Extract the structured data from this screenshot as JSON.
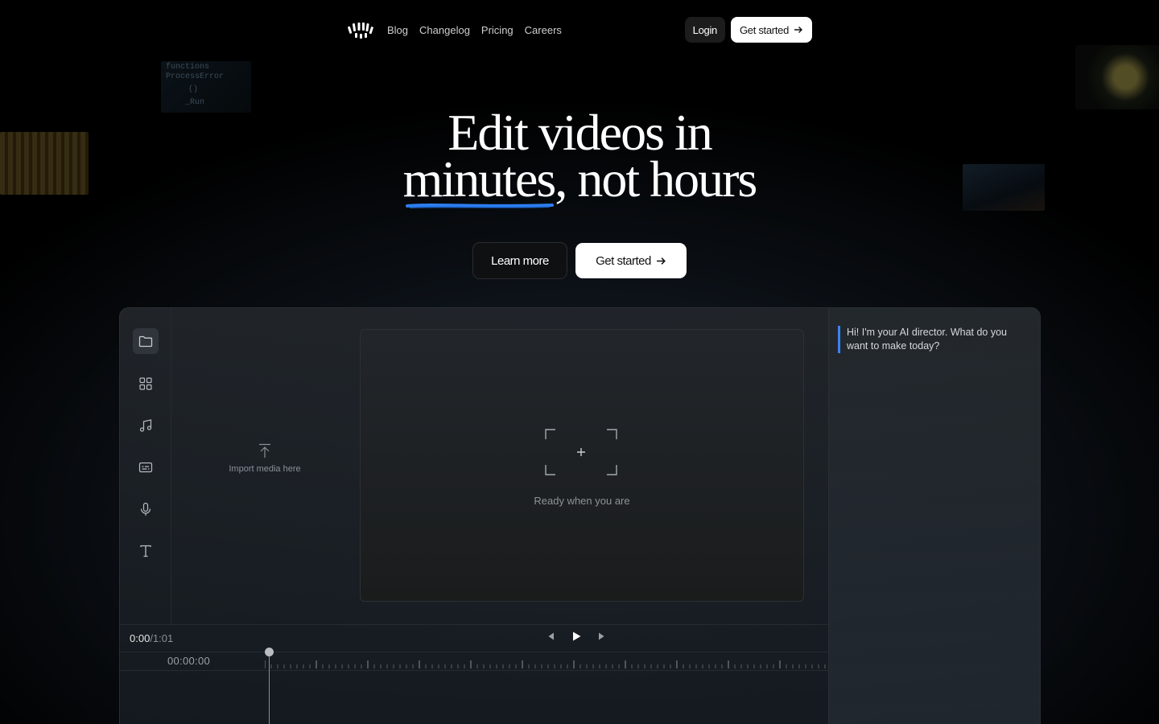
{
  "nav": {
    "links": [
      "Blog",
      "Changelog",
      "Pricing",
      "Careers"
    ],
    "login_label": "Login",
    "get_started_label": "Get started"
  },
  "hero": {
    "title_line1": "Edit videos in",
    "title_line2": "minutes, not hours",
    "learn_more_label": "Learn more",
    "get_started_label": "Get started"
  },
  "thumbnails": {
    "code_lines": [
      "functions",
      "ProcessError",
      "()",
      "_Run"
    ]
  },
  "editor": {
    "tools": [
      "folder-icon",
      "grid-icon",
      "music-icon",
      "captions-icon",
      "microphone-icon",
      "text-icon"
    ],
    "import_label": "Import media here",
    "preview_label": "Ready when you are",
    "chat_message": "Hi! I'm your AI director. What do you want to make today?",
    "time_current": "0:00",
    "time_total": "/1:01",
    "timecode": "00:00:00"
  },
  "colors": {
    "accent": "#3b82f6",
    "background": "#000000"
  }
}
